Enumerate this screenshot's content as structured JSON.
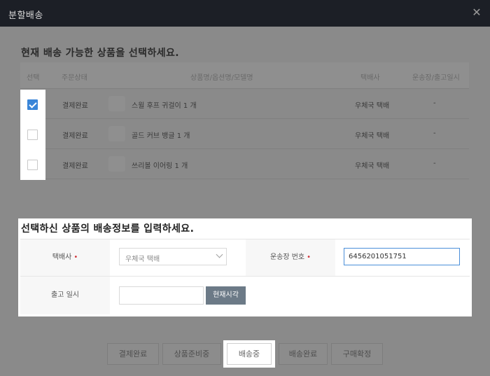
{
  "modal": {
    "title": "분할배송",
    "close_glyph": "✕"
  },
  "section1": {
    "heading": "현재 배송 가능한 상품을 선택하세요.",
    "columns": [
      "선택",
      "주문상태",
      "상품명/옵션명/모델명",
      "택배사",
      "운송장/출고일시"
    ],
    "rows": [
      {
        "checked": true,
        "status": "결제완료",
        "product": "스윌 후프 귀걸이 1 개",
        "courier": "우체국 택배",
        "tracking": "-"
      },
      {
        "checked": false,
        "status": "결제완료",
        "product": "골드 커브 뱅글 1 개",
        "courier": "우체국 택배",
        "tracking": "-"
      },
      {
        "checked": false,
        "status": "결제완료",
        "product": "쓰리볼 이어링 1 개",
        "courier": "우체국 택배",
        "tracking": "-"
      }
    ]
  },
  "section2": {
    "heading": "선택하신 상품의 배송정보를 입력하세요.",
    "courier_label": "택배사",
    "courier_value": "우체국 택배",
    "tracking_label": "운송장 번호",
    "tracking_value": "6456201051751",
    "ship_date_label": "출고 일시",
    "now_button": "현재시각",
    "required_mark": "•"
  },
  "status_buttons": [
    "결제완료",
    "상품준비중",
    "배송중",
    "배송완료",
    "구매확정"
  ],
  "active_status": "배송중",
  "colors": {
    "titlebar": "#1c1f26",
    "checkbox_checked": "#3b86d8",
    "required": "#d0343a",
    "now_button": "#6c7a87"
  }
}
